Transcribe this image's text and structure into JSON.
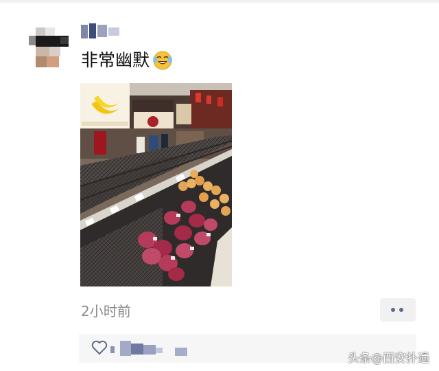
{
  "post": {
    "text": "非常幽默",
    "emoji": "face-with-tears-of-joy",
    "time": "2小时前"
  },
  "watermark": "头条@西安扑通",
  "colors": {
    "link_blue": "#5c6b8a",
    "meta_gray": "#8a8a8a",
    "bar_bg": "#f6f6f6"
  }
}
